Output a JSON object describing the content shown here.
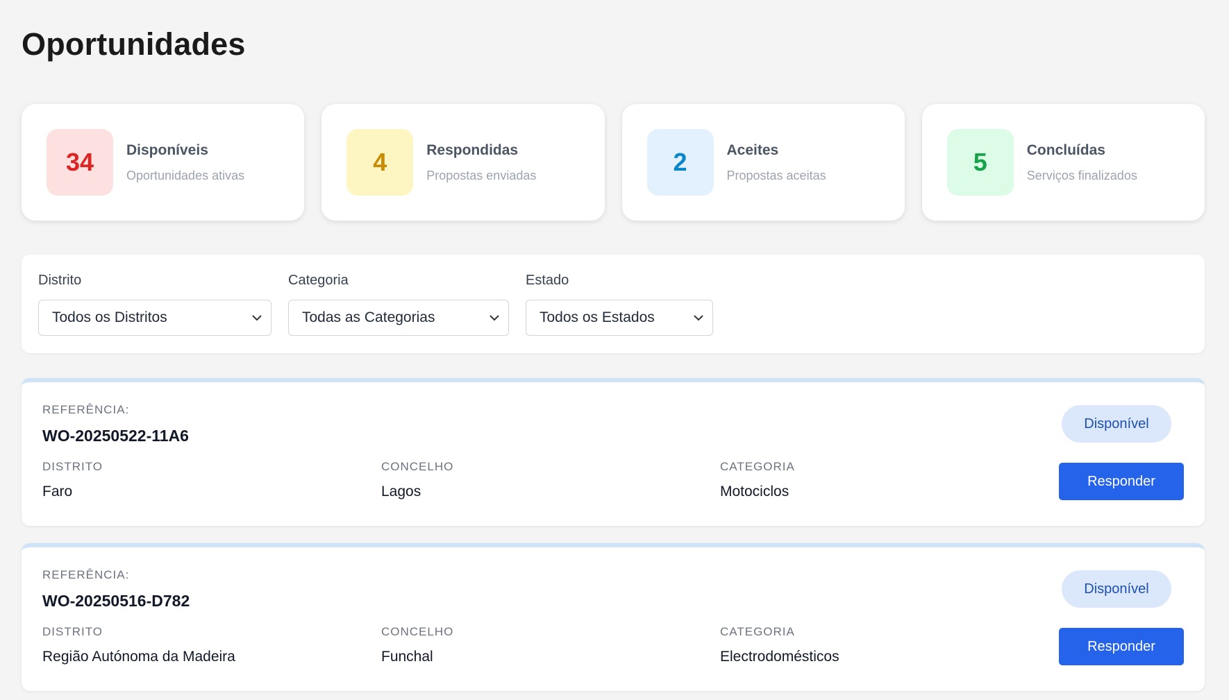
{
  "page": {
    "title": "Oportunidades"
  },
  "stats": [
    {
      "value": "34",
      "label": "Disponíveis",
      "sub": "Oportunidades ativas",
      "color": "#dc2626"
    },
    {
      "value": "4",
      "label": "Respondidas",
      "sub": "Propostas enviadas",
      "color": "#c98a04"
    },
    {
      "value": "2",
      "label": "Aceites",
      "sub": "Propostas aceitas",
      "color": "#0a86c9"
    },
    {
      "value": "5",
      "label": "Concluídas",
      "sub": "Serviços finalizados",
      "color": "#17a34a"
    }
  ],
  "filters": {
    "district": {
      "label": "Distrito",
      "value": "Todos os Distritos"
    },
    "category": {
      "label": "Categoria",
      "value": "Todas as Categorias"
    },
    "status": {
      "label": "Estado",
      "value": "Todos os Estados"
    }
  },
  "opportunities": [
    {
      "ref_label": "REFERÊNCIA:",
      "ref": "WO-20250522-11A6",
      "district_label": "DISTRITO",
      "district": "Faro",
      "municipality_label": "CONCELHO",
      "municipality": "Lagos",
      "category_label": "CATEGORIA",
      "category": "Motociclos",
      "status": "Disponível",
      "action": "Responder"
    },
    {
      "ref_label": "REFERÊNCIA:",
      "ref": "WO-20250516-D782",
      "district_label": "DISTRITO",
      "district": "Região Autónoma da Madeira",
      "municipality_label": "CONCELHO",
      "municipality": "Funchal",
      "category_label": "CATEGORIA",
      "category": "Electrodomésticos",
      "status": "Disponível",
      "action": "Responder"
    }
  ],
  "colors": {
    "accent": "#2563eb",
    "badge_bg": "#dbe8fb",
    "card_top_border": "#cfe3f8"
  },
  "icons": {
    "select_chevron": "chevron-down-icon"
  }
}
